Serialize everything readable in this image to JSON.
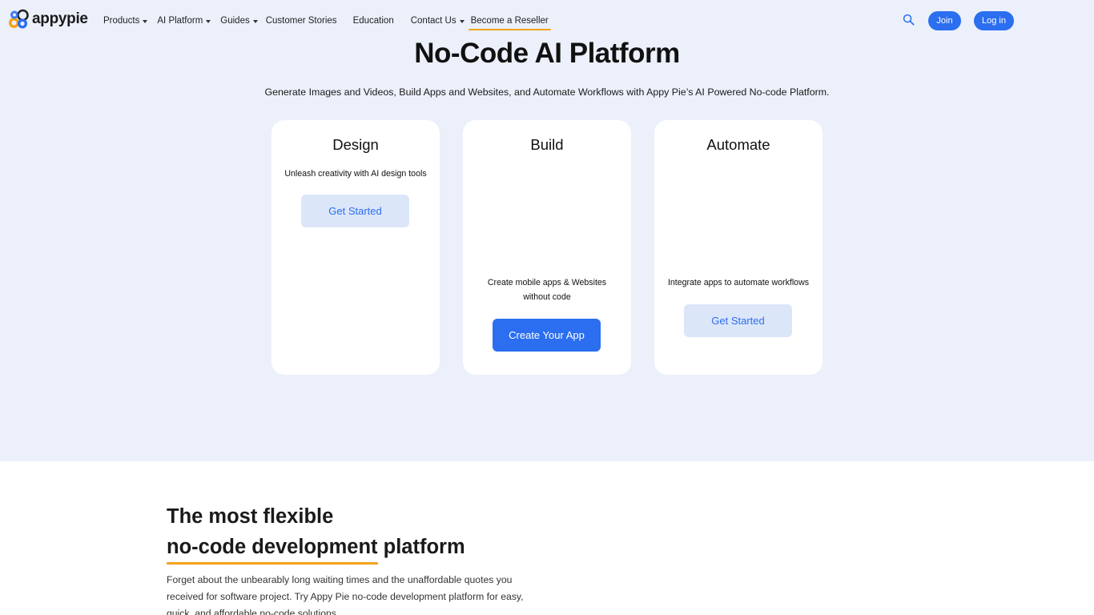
{
  "brand": {
    "name": "appypie"
  },
  "nav": {
    "items": [
      {
        "label": "Products",
        "dropdown": true
      },
      {
        "label": "AI Platform",
        "dropdown": true
      },
      {
        "label": "Guides",
        "dropdown": true
      },
      {
        "label": "Customer Stories",
        "dropdown": false
      },
      {
        "label": "Education",
        "dropdown": false
      },
      {
        "label": "Contact Us",
        "dropdown": true
      },
      {
        "label": "Become a Reseller",
        "dropdown": false
      }
    ],
    "search_icon": "search-icon",
    "join_label": "Join",
    "login_label": "Log in"
  },
  "hero": {
    "title": "No-Code AI Platform",
    "subtitle": "Generate Images and Videos, Build Apps and Websites, and Automate Workflows with Appy Pie’s AI Powered No-code Platform."
  },
  "cards": [
    {
      "title": "Design",
      "description": "Unleash creativity with AI design tools",
      "button": "Get Started"
    },
    {
      "title": "Build",
      "description": "Create mobile apps & Websites without code",
      "button": "Create Your App"
    },
    {
      "title": "Automate",
      "description": "Integrate apps to automate workflows",
      "button": "Get Started"
    }
  ],
  "flexible": {
    "title_line1": "The most flexible",
    "title_highlight": "no-code development",
    "title_rest": " platform",
    "description": "Forget about the unbearably long waiting times and the unaffordable quotes you received for software project. Try Appy Pie no-code development platform for easy, quick, and affordable no-code solutions."
  },
  "colors": {
    "accent": "#2b6ef0",
    "highlight": "#f4a21a",
    "hero_bg": "#ebf0fb",
    "light_button": "#dce6f9"
  }
}
